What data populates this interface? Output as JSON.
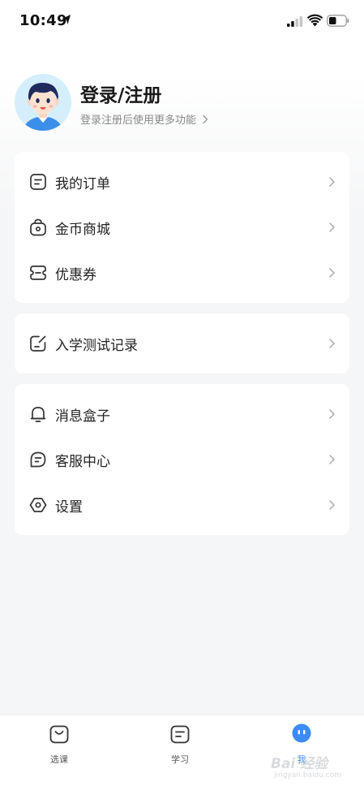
{
  "status_bar": {
    "time": "10:49"
  },
  "profile": {
    "title": "登录/注册",
    "subtitle": "登录注册后使用更多功能"
  },
  "menu_groups": [
    {
      "items": [
        {
          "label": "我的订单",
          "icon": "order-icon"
        },
        {
          "label": "金币商城",
          "icon": "shopping-bag-icon"
        },
        {
          "label": "优惠券",
          "icon": "coupon-icon"
        }
      ]
    },
    {
      "items": [
        {
          "label": "入学测试记录",
          "icon": "test-record-icon"
        }
      ]
    },
    {
      "items": [
        {
          "label": "消息盒子",
          "icon": "bell-icon"
        },
        {
          "label": "客服中心",
          "icon": "chat-icon"
        },
        {
          "label": "设置",
          "icon": "settings-icon"
        }
      ]
    }
  ],
  "bottom_nav": {
    "items": [
      {
        "label": "选课",
        "icon": "courses-icon",
        "active": false
      },
      {
        "label": "学习",
        "icon": "study-icon",
        "active": false
      },
      {
        "label": "我",
        "icon": "mine-icon",
        "active": true
      }
    ]
  },
  "watermark": {
    "text": "Bai 经验",
    "url": "jingyan.baidu.com"
  },
  "colors": {
    "accent": "#3d8cf5",
    "background": "#f5f6f7",
    "card": "#ffffff",
    "text": "#222222",
    "subtext": "#888888"
  }
}
